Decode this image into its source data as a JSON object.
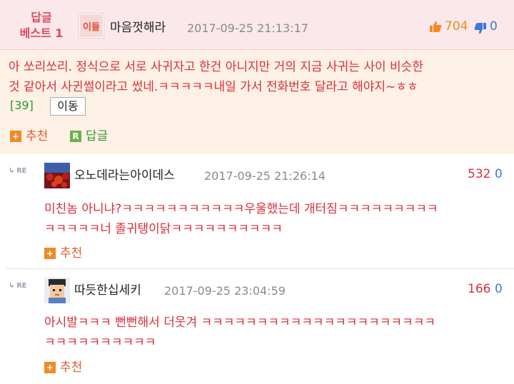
{
  "best": {
    "label_line1": "답글",
    "label_line2": "베스트 1",
    "avatar_text": "이들",
    "nick": "마음껏해라",
    "date": "2017-09-25 21:13:17",
    "up_count": "704",
    "down_count": "0",
    "body_line1": "아 쏘리쏘리. 정식으로 서로 사귀자고 한건 아니지만 거의 지금 사귀는 사이 비슷한",
    "body_line2": "것 같아서 사귄썰이라고 썼네.ㅋㅋㅋㅋㅋ내일 가서 전화번호 달라고 해야지~ㅎㅎ",
    "reply_count": "[39]",
    "move_label": "이동",
    "recommend_label": "추천",
    "reply_label": "답글",
    "plus_glyph": "+",
    "reply_glyph": "R"
  },
  "comments": [
    {
      "re_label": "RE",
      "nick": "오노데라는아이데스",
      "date": "2017-09-25 21:26:14",
      "up_count": "532",
      "down_count": "0",
      "body_line1": "미친놈 아니냐?ㅋㅋㅋㅋㅋㅋㅋㅋㅋㅋㅋ우울했는데 개터짐ㅋㅋㅋㅋㅋㅋㅋㅋㅋ",
      "body_line2": "ㅋㅋㅋㅋㅋ너 졸귀탱이닭ㅋㅋㅋㅋㅋㅋㅋㅋㅋㅋ",
      "recommend_label": "추천"
    },
    {
      "re_label": "RE",
      "nick": "따듯한십세키",
      "date": "2017-09-25 23:04:59",
      "up_count": "166",
      "down_count": "0",
      "body_line1": "아시발ㅋㅋㅋ 뻔뻔해서 더웃겨 ㅋㅋㅋㅋㅋㅋㅋㅋㅋㅋㅋㅋㅋㅋㅋㅋㅋㅋㅋㅋㅋ",
      "body_line2": "ㅋㅋㅋㅋㅋㅋㅋㅋㅋㅋ",
      "recommend_label": "추천"
    }
  ],
  "colors": {
    "accent_red": "#d8303a",
    "best_bg": "#fdf0e4",
    "best_header_bg": "#fbe8ea",
    "recommend_orange": "#f08a24",
    "reply_green": "#6cb04a",
    "thumb_down_blue": "#3a7bd5"
  },
  "icons": {
    "thumb_up": "thumb-up-icon",
    "thumb_down": "thumb-down-icon",
    "re": "reply-arrow-icon",
    "plus": "plus-square-icon",
    "reply": "r-square-icon"
  }
}
